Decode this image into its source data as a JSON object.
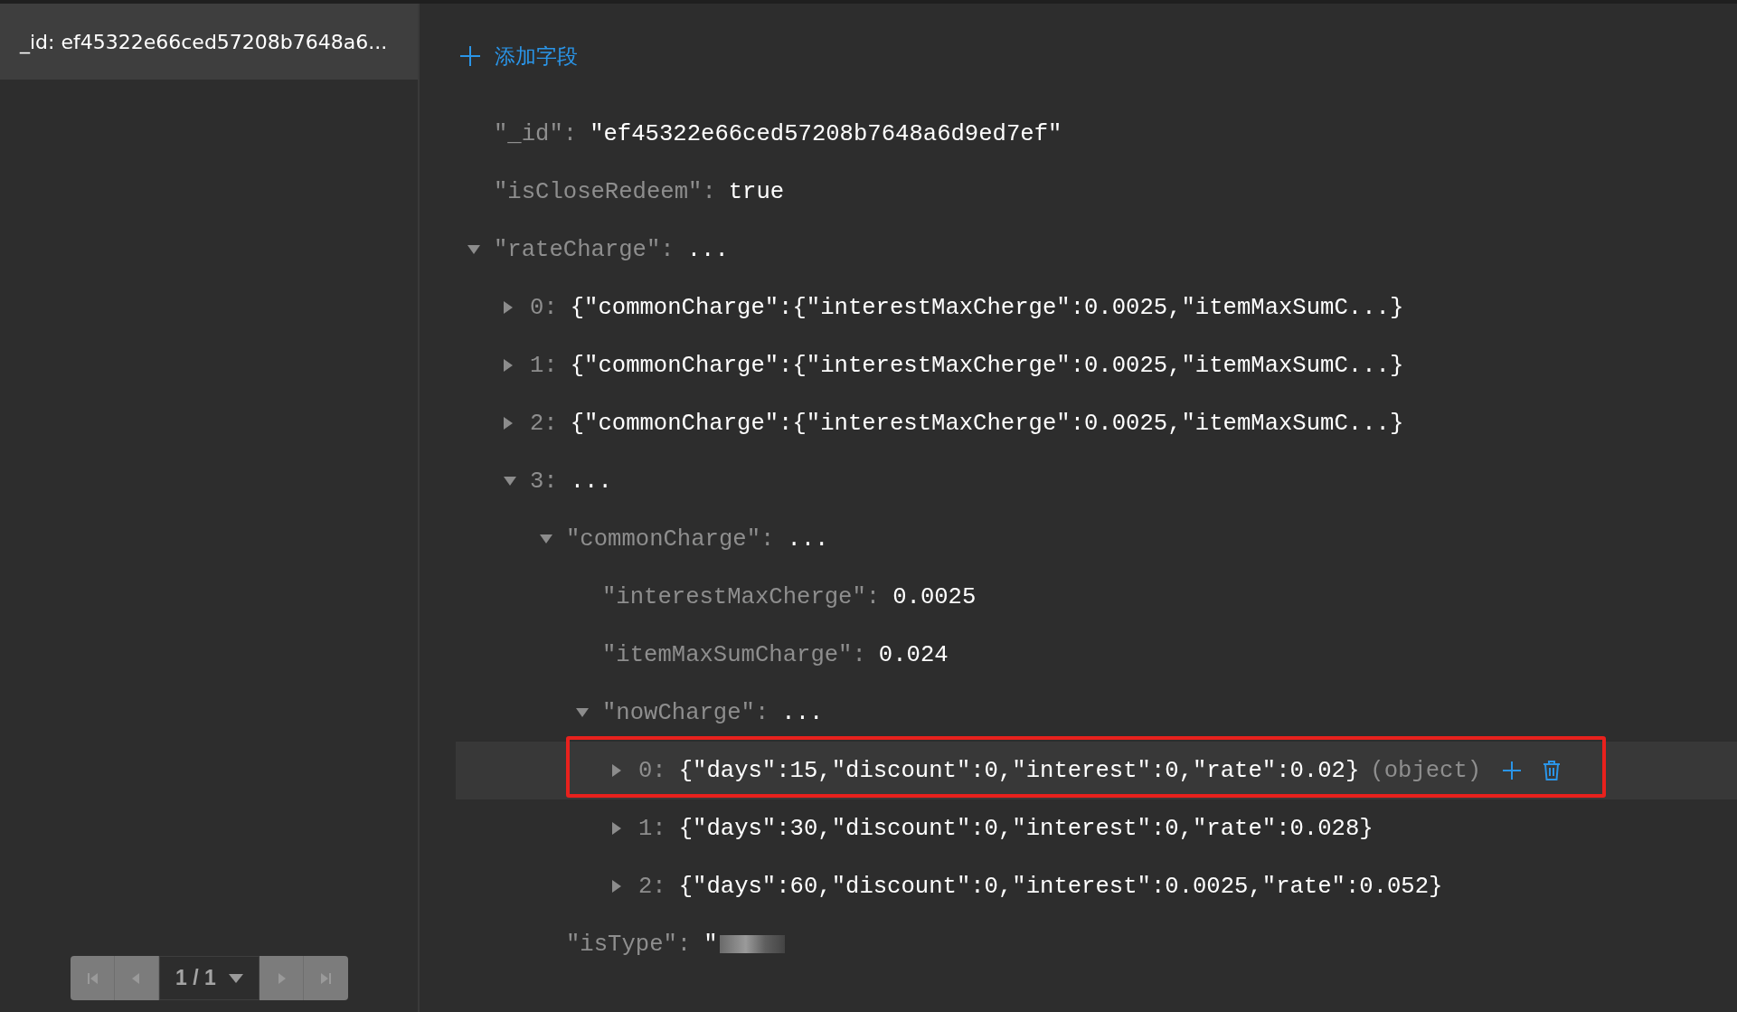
{
  "sidebar": {
    "items": [
      {
        "label": "_id: ef45322e66ced57208b7648a6...",
        "selected": true
      }
    ],
    "pagination": {
      "page": "1 / 1",
      "buttons": [
        {
          "kind": "first",
          "disabled": true
        },
        {
          "kind": "prev",
          "disabled": true
        },
        {
          "kind": "next",
          "disabled": true
        },
        {
          "kind": "last",
          "disabled": true
        }
      ]
    }
  },
  "editor": {
    "add_field": "添加字段",
    "tree": [
      {
        "key": "\"_id\":",
        "value": "\"ef45322e66ced57208b7648a6d9ed7ef\""
      },
      {
        "key": "\"isCloseRedeem\":",
        "value": "true"
      },
      {
        "key": "\"rateCharge\":",
        "value": "...",
        "expanded": true,
        "children": [
          {
            "key": "0:",
            "value": "{\"commonCharge\":{\"interestMaxCherge\":0.0025,\"itemMaxSumC...}",
            "expanded": false
          },
          {
            "key": "1:",
            "value": "{\"commonCharge\":{\"interestMaxCherge\":0.0025,\"itemMaxSumC...}",
            "expanded": false
          },
          {
            "key": "2:",
            "value": "{\"commonCharge\":{\"interestMaxCherge\":0.0025,\"itemMaxSumC...}",
            "expanded": false
          },
          {
            "key": "3:",
            "value": "...",
            "expanded": true,
            "children": [
              {
                "key": "\"commonCharge\":",
                "value": "...",
                "expanded": true,
                "children": [
                  {
                    "key": "\"interestMaxCherge\":",
                    "value": "0.0025"
                  },
                  {
                    "key": "\"itemMaxSumCharge\":",
                    "value": "0.024"
                  },
                  {
                    "key": "\"nowCharge\":",
                    "value": "...",
                    "expanded": true,
                    "children": [
                      {
                        "key": "0:",
                        "value": "{\"days\":15,\"discount\":0,\"interest\":0,\"rate\":0.02}",
                        "expanded": false,
                        "hovered": true,
                        "annotated": true,
                        "type_label": "(object)"
                      },
                      {
                        "key": "1:",
                        "value": "{\"days\":30,\"discount\":0,\"interest\":0,\"rate\":0.028}",
                        "expanded": false
                      },
                      {
                        "key": "2:",
                        "value": "{\"days\":60,\"discount\":0,\"interest\":0.0025,\"rate\":0.052}",
                        "expanded": false
                      }
                    ]
                  }
                ]
              },
              {
                "key": "\"isType\":",
                "value": "\"",
                "redacted": true
              }
            ]
          }
        ]
      }
    ]
  }
}
